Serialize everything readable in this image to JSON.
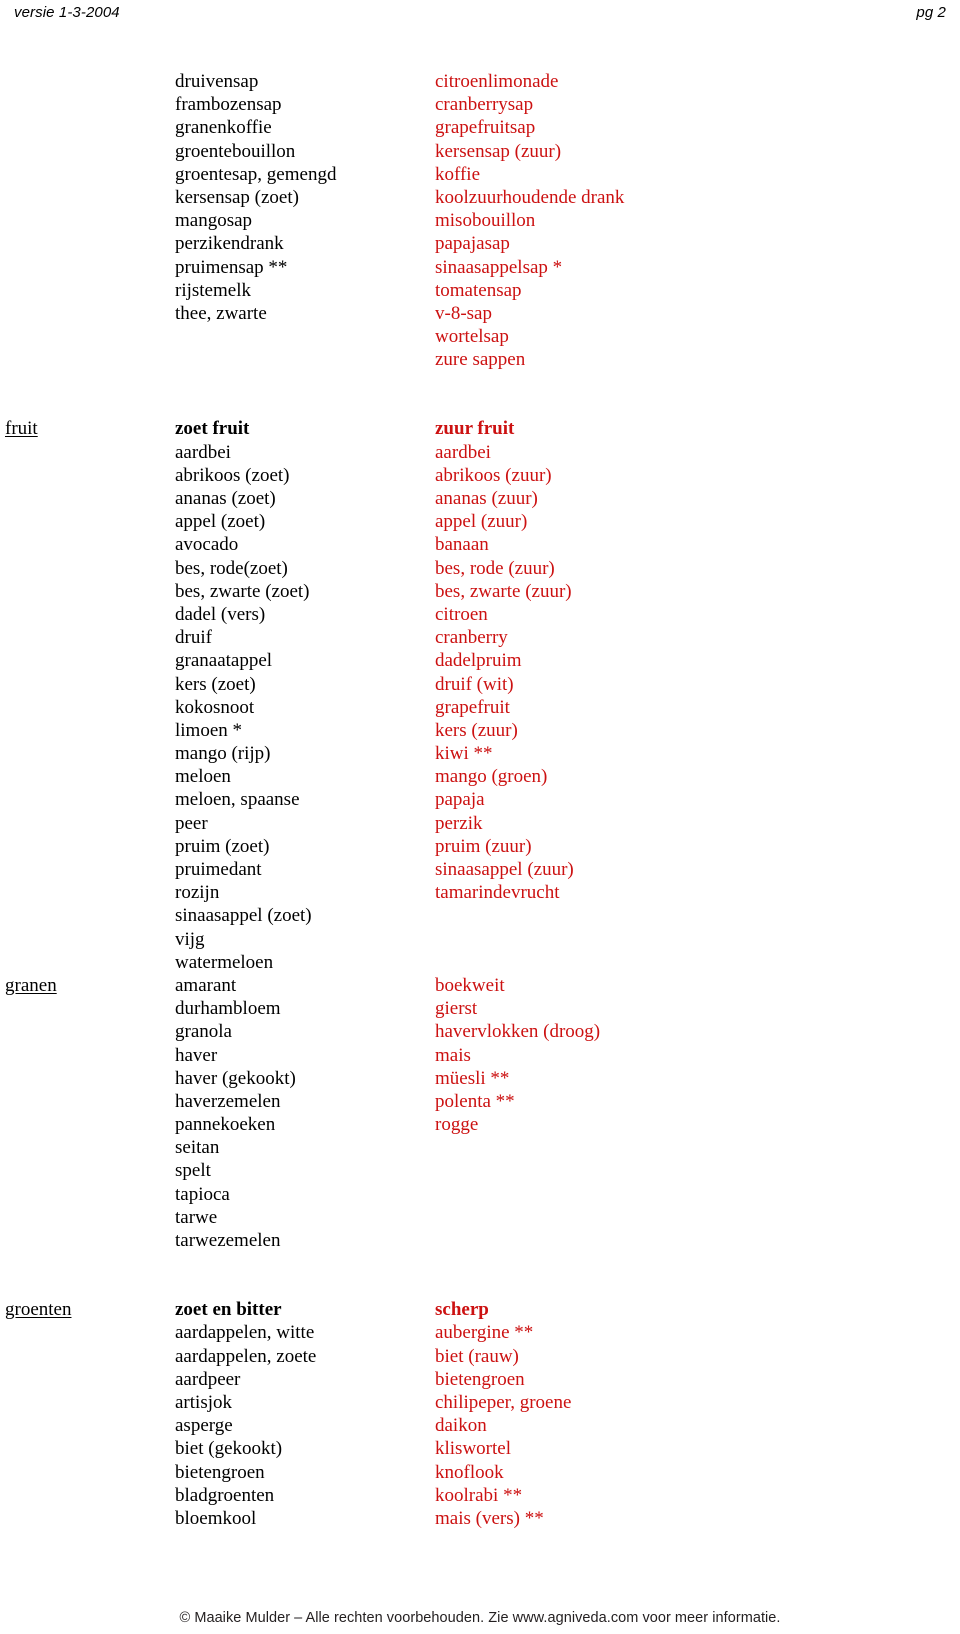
{
  "header": {
    "version": "versie 1-3-2004",
    "page": "pg 2"
  },
  "colors": {
    "sweet_text": "#000000",
    "sour_text": "#cc1111",
    "header_text": "#000000",
    "footer_text": "#231f20",
    "background": "#ffffff"
  },
  "footer": {
    "copyright": "© Maaike Mulder – Alle rechten voorbehouden. Zie www.agniveda.com voor meer informatie."
  },
  "sections": [
    {
      "label": "",
      "col_sweet_header": "",
      "col_sour_header": "",
      "rows": [
        {
          "label": "",
          "sweet": "druivensap",
          "sour": "citroenlimonade"
        },
        {
          "label": "",
          "sweet": "frambozensap",
          "sour": "cranberrysap"
        },
        {
          "label": "",
          "sweet": "granenkoffie",
          "sour": "grapefruitsap"
        },
        {
          "label": "",
          "sweet": "groentebouillon",
          "sour": "kersensap (zuur)"
        },
        {
          "label": "",
          "sweet": "groentesap, gemengd",
          "sour": "koffie"
        },
        {
          "label": "",
          "sweet": "kersensap (zoet)",
          "sour": "koolzuurhoudende drank"
        },
        {
          "label": "",
          "sweet": "mangosap",
          "sour": "misobouillon"
        },
        {
          "label": "",
          "sweet": "perzikendrank",
          "sour": "papajasap"
        },
        {
          "label": "",
          "sweet": "pruimensap **",
          "sour": "sinaasappelsap *"
        },
        {
          "label": "",
          "sweet": "rijstemelk",
          "sour": "tomatensap"
        },
        {
          "label": "",
          "sweet": "thee, zwarte",
          "sour": "v-8-sap"
        },
        {
          "label": "",
          "sweet": "",
          "sour": "wortelsap"
        },
        {
          "label": "",
          "sweet": "",
          "sour": "zure sappen"
        }
      ]
    },
    {
      "label": "fruit",
      "col_sweet_header": "zoet fruit",
      "col_sour_header": "zuur fruit",
      "rows": [
        {
          "label": "fruit",
          "sweet": "zoet fruit",
          "sour": "zuur fruit",
          "head": true
        },
        {
          "label": "",
          "sweet": "aardbei",
          "sour": "aardbei"
        },
        {
          "label": "",
          "sweet": "abrikoos (zoet)",
          "sour": "abrikoos (zuur)"
        },
        {
          "label": "",
          "sweet": "ananas (zoet)",
          "sour": "ananas (zuur)"
        },
        {
          "label": "",
          "sweet": "appel (zoet)",
          "sour": "appel (zuur)"
        },
        {
          "label": "",
          "sweet": "avocado",
          "sour": "banaan"
        },
        {
          "label": "",
          "sweet": "bes, rode(zoet)",
          "sour": "bes, rode (zuur)"
        },
        {
          "label": "",
          "sweet": "bes, zwarte (zoet)",
          "sour": "bes, zwarte (zuur)"
        },
        {
          "label": "",
          "sweet": "dadel (vers)",
          "sour": "citroen"
        },
        {
          "label": "",
          "sweet": "druif",
          "sour": "cranberry"
        },
        {
          "label": "",
          "sweet": "granaatappel",
          "sour": "dadelpruim"
        },
        {
          "label": "",
          "sweet": "kers (zoet)",
          "sour": "druif (wit)"
        },
        {
          "label": "",
          "sweet": "kokosnoot",
          "sour": "grapefruit"
        },
        {
          "label": "",
          "sweet": "limoen *",
          "sour": "kers (zuur)"
        },
        {
          "label": "",
          "sweet": "mango (rijp)",
          "sour": "kiwi **"
        },
        {
          "label": "",
          "sweet": "meloen",
          "sour": "mango (groen)"
        },
        {
          "label": "",
          "sweet": "meloen, spaanse",
          "sour": "papaja"
        },
        {
          "label": "",
          "sweet": "peer",
          "sour": "perzik"
        },
        {
          "label": "",
          "sweet": "pruim (zoet)",
          "sour": "pruim (zuur)"
        },
        {
          "label": "",
          "sweet": "pruimedant",
          "sour": "sinaasappel (zuur)"
        },
        {
          "label": "",
          "sweet": "rozijn",
          "sour": "tamarindevrucht"
        },
        {
          "label": "",
          "sweet": "sinaasappel (zoet)",
          "sour": ""
        },
        {
          "label": "",
          "sweet": "vijg",
          "sour": ""
        },
        {
          "label": "",
          "sweet": "watermeloen",
          "sour": ""
        }
      ]
    },
    {
      "label": "granen",
      "col_sweet_header": "",
      "col_sour_header": "",
      "rows": [
        {
          "label": "granen",
          "sweet": "amarant",
          "sour": "boekweit"
        },
        {
          "label": "",
          "sweet": "durhambloem",
          "sour": "gierst"
        },
        {
          "label": "",
          "sweet": "granola",
          "sour": "havervlokken (droog)"
        },
        {
          "label": "",
          "sweet": "haver",
          "sour": "mais"
        },
        {
          "label": "",
          "sweet": "haver (gekookt)",
          "sour": "müesli **"
        },
        {
          "label": "",
          "sweet": "haverzemelen",
          "sour": "polenta **"
        },
        {
          "label": "",
          "sweet": "pannekoeken",
          "sour": "rogge"
        },
        {
          "label": "",
          "sweet": "seitan",
          "sour": ""
        },
        {
          "label": "",
          "sweet": "spelt",
          "sour": ""
        },
        {
          "label": "",
          "sweet": "tapioca",
          "sour": ""
        },
        {
          "label": "",
          "sweet": "tarwe",
          "sour": ""
        },
        {
          "label": "",
          "sweet": "tarwezemelen",
          "sour": ""
        }
      ]
    },
    {
      "label": "groenten",
      "col_sweet_header": "zoet en bitter",
      "col_sour_header": "scherp",
      "rows": [
        {
          "label": "groenten",
          "sweet": "zoet en bitter",
          "sour": "scherp",
          "head": true
        },
        {
          "label": "",
          "sweet": "aardappelen, witte",
          "sour": "aubergine **"
        },
        {
          "label": "",
          "sweet": "aardappelen, zoete",
          "sour": "biet (rauw)"
        },
        {
          "label": "",
          "sweet": "aardpeer",
          "sour": "bietengroen"
        },
        {
          "label": "",
          "sweet": "artisjok",
          "sour": "chilipeper, groene"
        },
        {
          "label": "",
          "sweet": "asperge",
          "sour": "daikon"
        },
        {
          "label": "",
          "sweet": "biet (gekookt)",
          "sour": "kliswortel"
        },
        {
          "label": "",
          "sweet": "bietengroen",
          "sour": "knoflook"
        },
        {
          "label": "",
          "sweet": "bladgroenten",
          "sour": "koolrabi **"
        },
        {
          "label": "",
          "sweet": "bloemkool",
          "sour": "mais (vers) **"
        }
      ]
    }
  ]
}
